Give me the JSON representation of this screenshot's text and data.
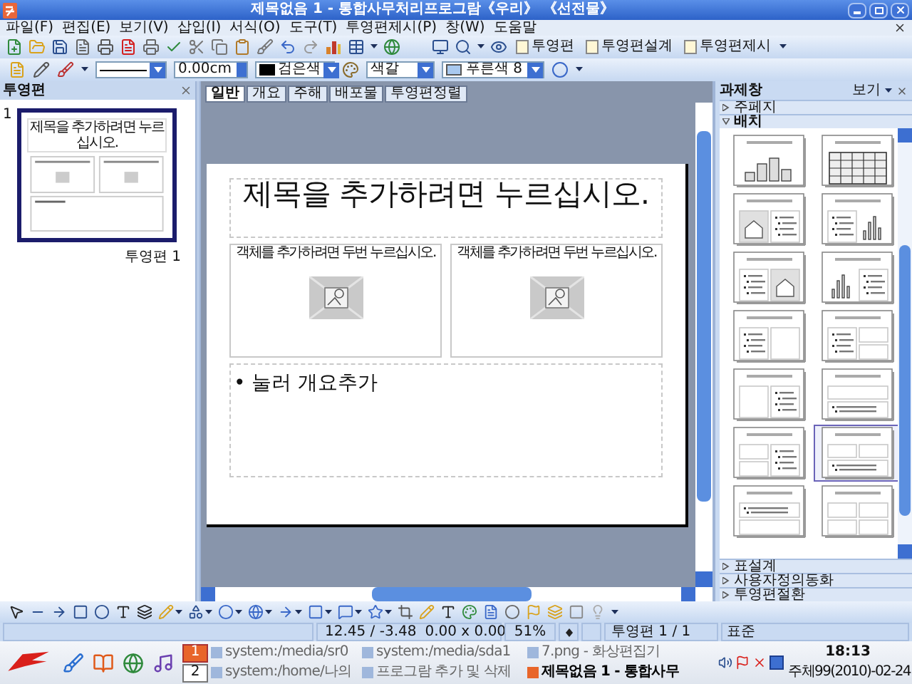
{
  "window": {
    "title": "제목없음 1 - 통합사무처리프로그람《우리》 《선전물》"
  },
  "menu": [
    "파일(F)",
    "편집(E)",
    "보기(V)",
    "삽입(I)",
    "서식(O)",
    "도구(T)",
    "투영편제시(P)",
    "창(W)",
    "도움말"
  ],
  "toolbar": {
    "buttons": [
      "투영편",
      "투영편설계",
      "투영편제시"
    ]
  },
  "format_bar": {
    "line_width": "0.00cm",
    "line_color": "검은색",
    "fill_type": "색갈",
    "fill_color": "푸른색 8"
  },
  "slides_panel": {
    "title": "투영편",
    "slides": [
      {
        "number": "1",
        "thumbnail_title": "제목을 추가하려면 누르십시오.",
        "label": "투영편 1",
        "selected": true
      }
    ]
  },
  "view_tabs": [
    {
      "label": "일반",
      "selected": true
    },
    {
      "label": "개요",
      "selected": false
    },
    {
      "label": "주해",
      "selected": false
    },
    {
      "label": "배포물",
      "selected": false
    },
    {
      "label": "투영편정렬",
      "selected": false
    }
  ],
  "slide": {
    "title": "제목을 추가하려면 누르십시오.",
    "objects": [
      "객체를 추가하려면 두번 누르십시오.",
      "객체를 추가하려면 두번 누르십시오."
    ],
    "outline": "• 눌러 개요추가"
  },
  "task_pane": {
    "title": "과제창",
    "view": "보기",
    "sections": [
      {
        "label": "주페지",
        "expanded": false
      },
      {
        "label": "배치",
        "expanded": true,
        "layouts": [
          {
            "kind": "chart",
            "selected": false
          },
          {
            "kind": "table",
            "selected": false
          },
          {
            "kind": "picture-text",
            "selected": false
          },
          {
            "kind": "text-chart",
            "selected": false
          },
          {
            "kind": "text-picture",
            "selected": false
          },
          {
            "kind": "chart-text",
            "selected": false
          },
          {
            "kind": "text-box",
            "selected": false
          },
          {
            "kind": "text-2box",
            "selected": false
          },
          {
            "kind": "box-text",
            "selected": false
          },
          {
            "kind": "box-wide",
            "selected": false
          },
          {
            "kind": "twoboxtext",
            "selected": false
          },
          {
            "kind": "twoboxwide",
            "selected": true
          },
          {
            "kind": "wide-box",
            "selected": false
          },
          {
            "kind": "fourbox",
            "selected": false
          }
        ]
      },
      {
        "label": "표설계",
        "expanded": false
      },
      {
        "label": "사용자정의동화",
        "expanded": false
      },
      {
        "label": "투영편절환",
        "expanded": false
      }
    ]
  },
  "status_bar": {
    "position": "12.45 / -3.48",
    "size": "0.00 x 0.00",
    "zoom": "51%",
    "slide": "투영편 1 / 1",
    "mode": "표준"
  },
  "taskbar": {
    "desktops": [
      {
        "label": "1",
        "selected": true
      },
      {
        "label": "2",
        "selected": false
      }
    ],
    "tasks": [
      {
        "label": "system:/media/sr0",
        "active": false
      },
      {
        "label": "system:/media/sda1",
        "active": false
      },
      {
        "label": "7.png - 화상편집기",
        "active": false
      },
      {
        "label": "system:/home/나의",
        "active": false
      },
      {
        "label": "프로그람 추가 및 삭제",
        "active": false
      },
      {
        "label": "제목없음 1 - 통합사무",
        "active": true
      }
    ],
    "clock": "18:13",
    "date": "주체99(2010)-02-24"
  }
}
